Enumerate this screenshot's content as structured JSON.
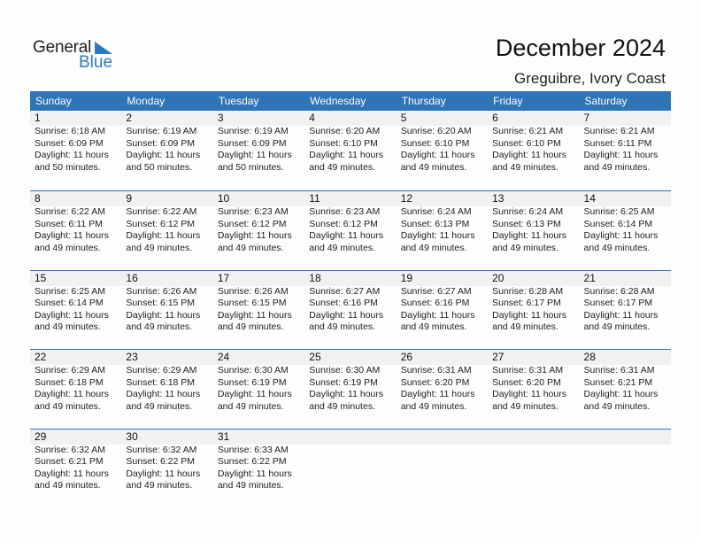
{
  "logo": {
    "general": "General",
    "blue": "Blue"
  },
  "header": {
    "title": "December 2024",
    "location": "Greguibre, Ivory Coast"
  },
  "colors": {
    "accent": "#2f74b5",
    "strip": "#f1f1f1"
  },
  "weekdays": [
    "Sunday",
    "Monday",
    "Tuesday",
    "Wednesday",
    "Thursday",
    "Friday",
    "Saturday"
  ],
  "weeks": [
    [
      {
        "day": "1",
        "sunrise": "Sunrise: 6:18 AM",
        "sunset": "Sunset: 6:09 PM",
        "daylight1": "Daylight: 11 hours",
        "daylight2": "and 50 minutes."
      },
      {
        "day": "2",
        "sunrise": "Sunrise: 6:19 AM",
        "sunset": "Sunset: 6:09 PM",
        "daylight1": "Daylight: 11 hours",
        "daylight2": "and 50 minutes."
      },
      {
        "day": "3",
        "sunrise": "Sunrise: 6:19 AM",
        "sunset": "Sunset: 6:09 PM",
        "daylight1": "Daylight: 11 hours",
        "daylight2": "and 50 minutes."
      },
      {
        "day": "4",
        "sunrise": "Sunrise: 6:20 AM",
        "sunset": "Sunset: 6:10 PM",
        "daylight1": "Daylight: 11 hours",
        "daylight2": "and 49 minutes."
      },
      {
        "day": "5",
        "sunrise": "Sunrise: 6:20 AM",
        "sunset": "Sunset: 6:10 PM",
        "daylight1": "Daylight: 11 hours",
        "daylight2": "and 49 minutes."
      },
      {
        "day": "6",
        "sunrise": "Sunrise: 6:21 AM",
        "sunset": "Sunset: 6:10 PM",
        "daylight1": "Daylight: 11 hours",
        "daylight2": "and 49 minutes."
      },
      {
        "day": "7",
        "sunrise": "Sunrise: 6:21 AM",
        "sunset": "Sunset: 6:11 PM",
        "daylight1": "Daylight: 11 hours",
        "daylight2": "and 49 minutes."
      }
    ],
    [
      {
        "day": "8",
        "sunrise": "Sunrise: 6:22 AM",
        "sunset": "Sunset: 6:11 PM",
        "daylight1": "Daylight: 11 hours",
        "daylight2": "and 49 minutes."
      },
      {
        "day": "9",
        "sunrise": "Sunrise: 6:22 AM",
        "sunset": "Sunset: 6:12 PM",
        "daylight1": "Daylight: 11 hours",
        "daylight2": "and 49 minutes."
      },
      {
        "day": "10",
        "sunrise": "Sunrise: 6:23 AM",
        "sunset": "Sunset: 6:12 PM",
        "daylight1": "Daylight: 11 hours",
        "daylight2": "and 49 minutes."
      },
      {
        "day": "11",
        "sunrise": "Sunrise: 6:23 AM",
        "sunset": "Sunset: 6:12 PM",
        "daylight1": "Daylight: 11 hours",
        "daylight2": "and 49 minutes."
      },
      {
        "day": "12",
        "sunrise": "Sunrise: 6:24 AM",
        "sunset": "Sunset: 6:13 PM",
        "daylight1": "Daylight: 11 hours",
        "daylight2": "and 49 minutes."
      },
      {
        "day": "13",
        "sunrise": "Sunrise: 6:24 AM",
        "sunset": "Sunset: 6:13 PM",
        "daylight1": "Daylight: 11 hours",
        "daylight2": "and 49 minutes."
      },
      {
        "day": "14",
        "sunrise": "Sunrise: 6:25 AM",
        "sunset": "Sunset: 6:14 PM",
        "daylight1": "Daylight: 11 hours",
        "daylight2": "and 49 minutes."
      }
    ],
    [
      {
        "day": "15",
        "sunrise": "Sunrise: 6:25 AM",
        "sunset": "Sunset: 6:14 PM",
        "daylight1": "Daylight: 11 hours",
        "daylight2": "and 49 minutes."
      },
      {
        "day": "16",
        "sunrise": "Sunrise: 6:26 AM",
        "sunset": "Sunset: 6:15 PM",
        "daylight1": "Daylight: 11 hours",
        "daylight2": "and 49 minutes."
      },
      {
        "day": "17",
        "sunrise": "Sunrise: 6:26 AM",
        "sunset": "Sunset: 6:15 PM",
        "daylight1": "Daylight: 11 hours",
        "daylight2": "and 49 minutes."
      },
      {
        "day": "18",
        "sunrise": "Sunrise: 6:27 AM",
        "sunset": "Sunset: 6:16 PM",
        "daylight1": "Daylight: 11 hours",
        "daylight2": "and 49 minutes."
      },
      {
        "day": "19",
        "sunrise": "Sunrise: 6:27 AM",
        "sunset": "Sunset: 6:16 PM",
        "daylight1": "Daylight: 11 hours",
        "daylight2": "and 49 minutes."
      },
      {
        "day": "20",
        "sunrise": "Sunrise: 6:28 AM",
        "sunset": "Sunset: 6:17 PM",
        "daylight1": "Daylight: 11 hours",
        "daylight2": "and 49 minutes."
      },
      {
        "day": "21",
        "sunrise": "Sunrise: 6:28 AM",
        "sunset": "Sunset: 6:17 PM",
        "daylight1": "Daylight: 11 hours",
        "daylight2": "and 49 minutes."
      }
    ],
    [
      {
        "day": "22",
        "sunrise": "Sunrise: 6:29 AM",
        "sunset": "Sunset: 6:18 PM",
        "daylight1": "Daylight: 11 hours",
        "daylight2": "and 49 minutes."
      },
      {
        "day": "23",
        "sunrise": "Sunrise: 6:29 AM",
        "sunset": "Sunset: 6:18 PM",
        "daylight1": "Daylight: 11 hours",
        "daylight2": "and 49 minutes."
      },
      {
        "day": "24",
        "sunrise": "Sunrise: 6:30 AM",
        "sunset": "Sunset: 6:19 PM",
        "daylight1": "Daylight: 11 hours",
        "daylight2": "and 49 minutes."
      },
      {
        "day": "25",
        "sunrise": "Sunrise: 6:30 AM",
        "sunset": "Sunset: 6:19 PM",
        "daylight1": "Daylight: 11 hours",
        "daylight2": "and 49 minutes."
      },
      {
        "day": "26",
        "sunrise": "Sunrise: 6:31 AM",
        "sunset": "Sunset: 6:20 PM",
        "daylight1": "Daylight: 11 hours",
        "daylight2": "and 49 minutes."
      },
      {
        "day": "27",
        "sunrise": "Sunrise: 6:31 AM",
        "sunset": "Sunset: 6:20 PM",
        "daylight1": "Daylight: 11 hours",
        "daylight2": "and 49 minutes."
      },
      {
        "day": "28",
        "sunrise": "Sunrise: 6:31 AM",
        "sunset": "Sunset: 6:21 PM",
        "daylight1": "Daylight: 11 hours",
        "daylight2": "and 49 minutes."
      }
    ],
    [
      {
        "day": "29",
        "sunrise": "Sunrise: 6:32 AM",
        "sunset": "Sunset: 6:21 PM",
        "daylight1": "Daylight: 11 hours",
        "daylight2": "and 49 minutes."
      },
      {
        "day": "30",
        "sunrise": "Sunrise: 6:32 AM",
        "sunset": "Sunset: 6:22 PM",
        "daylight1": "Daylight: 11 hours",
        "daylight2": "and 49 minutes."
      },
      {
        "day": "31",
        "sunrise": "Sunrise: 6:33 AM",
        "sunset": "Sunset: 6:22 PM",
        "daylight1": "Daylight: 11 hours",
        "daylight2": "and 49 minutes."
      },
      null,
      null,
      null,
      null
    ]
  ]
}
